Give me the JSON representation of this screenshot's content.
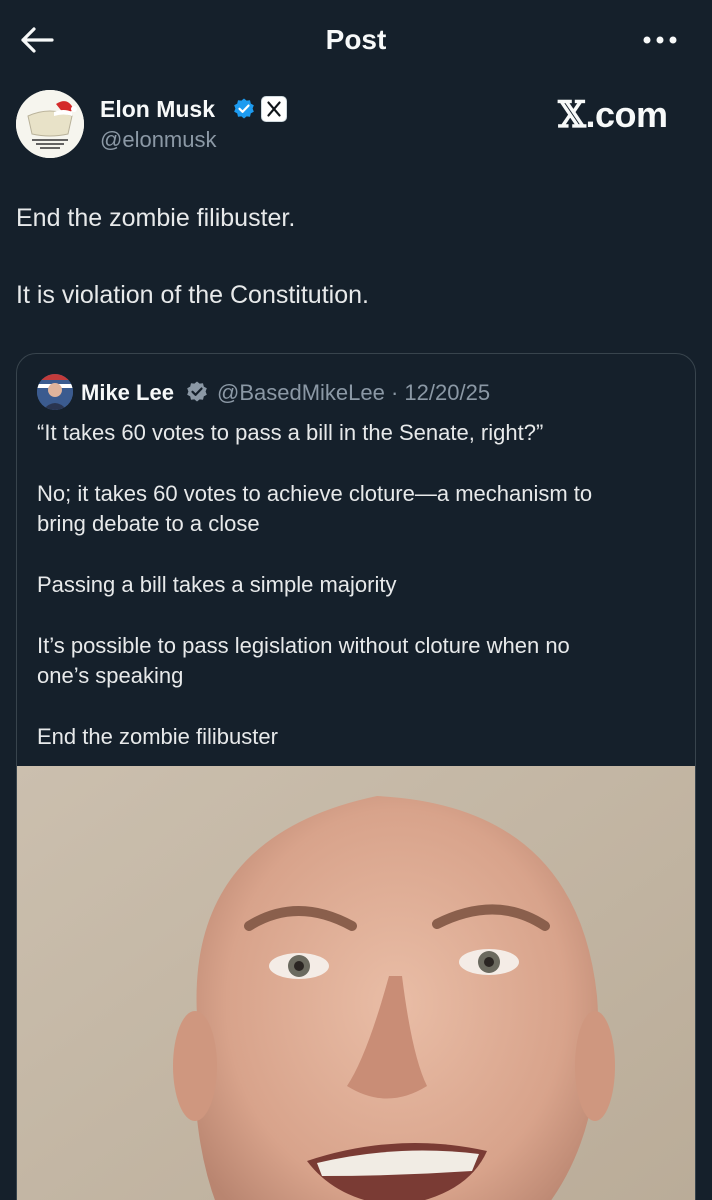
{
  "header": {
    "title": "Post",
    "back_icon": "arrow-left-icon",
    "more_icon": "more-horizontal-icon"
  },
  "post": {
    "author": {
      "name": "Elon Musk",
      "handle": "@elonmusk",
      "verified_color": "#1d9bf0",
      "affiliation_badge": "x-logo-icon"
    },
    "watermark": {
      "x": "𝕏",
      "rest": ".com"
    },
    "paragraphs": [
      "End the zombie filibuster.",
      "It is violation of the Constitution."
    ]
  },
  "quote": {
    "author": {
      "name": "Mike Lee",
      "handle": "@BasedMikeLee · 12/20/25"
    },
    "lines": [
      "“It takes 60 votes to pass a bill in the Senate, right?”",
      "No; it takes 60 votes to achieve cloture—a mechanism to",
      "bring debate to a close",
      "Passing a bill takes a simple majority",
      "It’s possible to pass legislation without cloture when no",
      "one’s speaking",
      "End the zombie filibuster"
    ]
  },
  "colors": {
    "background": "#15202b",
    "text": "#e7e9ea",
    "secondary": "#8b98a5",
    "border": "#38444d",
    "accent": "#1d9bf0"
  }
}
